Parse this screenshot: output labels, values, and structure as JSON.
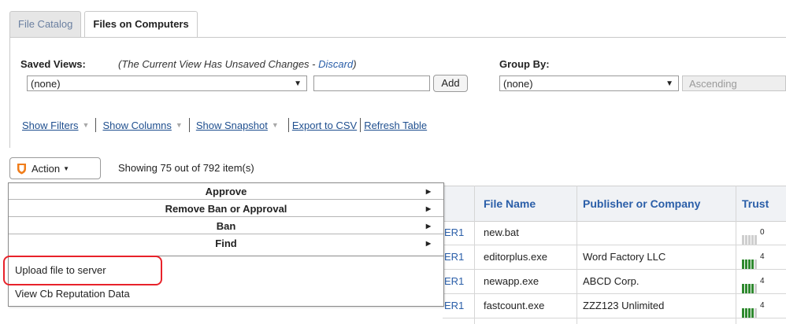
{
  "tabs": [
    {
      "label": "File Catalog",
      "active": false
    },
    {
      "label": "Files on Computers",
      "active": true
    }
  ],
  "saved_views": {
    "label": "Saved Views:",
    "note_prefix": "(The Current View Has Unsaved Changes - ",
    "discard": "Discard",
    "note_suffix": ")",
    "selected": "(none)",
    "name_value": "",
    "add_label": "Add"
  },
  "group_by": {
    "label": "Group By:",
    "selected": "(none)",
    "order": "Ascending"
  },
  "links": {
    "show_filters": "Show Filters",
    "show_columns": "Show Columns",
    "show_snapshot": "Show Snapshot",
    "export_csv": "Export to CSV",
    "refresh_table": "Refresh Table"
  },
  "action": {
    "label": "Action",
    "showing": "Showing 75 out of 792 item(s)",
    "shield_color": "#f07d1a"
  },
  "menu": {
    "submenus": [
      "Approve",
      "Remove Ban or Approval",
      "Ban",
      "Find"
    ],
    "items": [
      "Upload file to server",
      "View Cb Reputation Data"
    ]
  },
  "table": {
    "columns": [
      "File Name",
      "Publisher or Company",
      "Trust"
    ],
    "rows": [
      {
        "computer": "ER1",
        "file": "new.bat",
        "publisher": "",
        "trust": "0",
        "trust_level": 0
      },
      {
        "computer": "ER1",
        "file": "editorplus.exe",
        "publisher": "Word Factory LLC",
        "trust": "4",
        "trust_level": 4
      },
      {
        "computer": "ER1",
        "file": "newapp.exe",
        "publisher": "ABCD Corp.",
        "trust": "4",
        "trust_level": 4
      },
      {
        "computer": "ER1",
        "file": "fastcount.exe",
        "publisher": "ZZZ123 Unlimited",
        "trust": "4",
        "trust_level": 4
      }
    ]
  },
  "colors": {
    "link": "#1f4f8f",
    "trust_on": "#2f8a2f",
    "trust_off": "#cfcfcf",
    "highlight": "#e8222a"
  }
}
